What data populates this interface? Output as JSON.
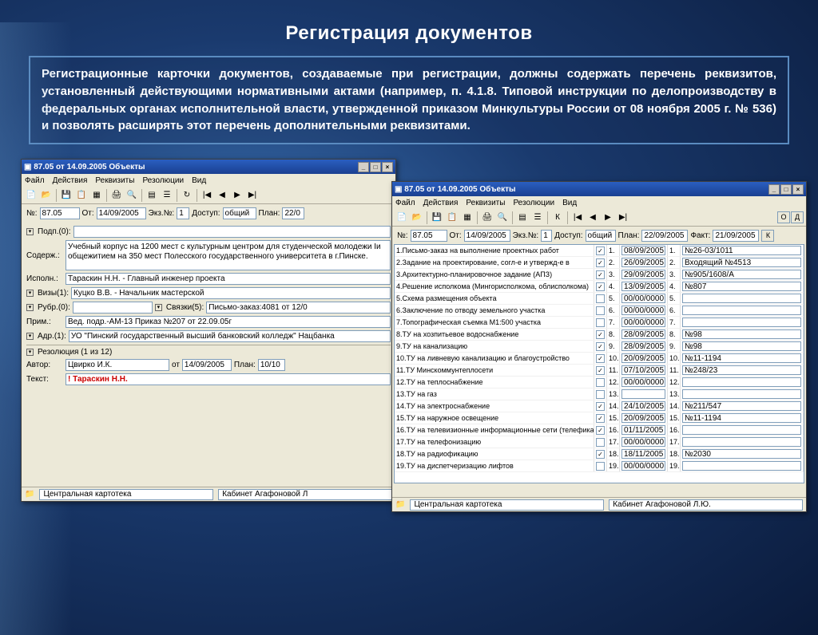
{
  "slide": {
    "title": "Регистрация документов",
    "body": "Регистрационные карточки документов, создаваемые при регистрации, должны содержать перечень реквизитов, установленный действующими нормативными актами (например, п. 4.1.8. Типовой инструкции по делопроизводству в федеральных органах исполнительной власти, утвержденной приказом Минкультуры России от 08 ноября 2005 г. № 536) и позволять расширять этот перечень дополнительными реквизитами."
  },
  "win1": {
    "title": "87.05 от 14.09.2005 Объекты",
    "menu": [
      "Файл",
      "Действия",
      "Реквизиты",
      "Резолюции",
      "Вид"
    ],
    "header": {
      "num_label": "№:",
      "num": "87.05",
      "date_label": "От:",
      "date": "14/09/2005",
      "copy_label": "Экз.№:",
      "copy": "1",
      "access_label": "Доступ:",
      "access": "общий",
      "plan_label": "План:",
      "plan": "22/0"
    },
    "fields": {
      "sign_label": "Подп.(0):",
      "content_label": "Содерж.:",
      "content": "Учебный корпус на 1200 мест с культурным центром для студенческой молодежи Iи общежитием на 350 мест Полесского государственного университета в г.Пинске.",
      "exec_label": "Исполн.:",
      "exec": "Тараскин Н.Н. - Главный инженер проекта",
      "visa_label": "Визы(1):",
      "visa": "Куцко В.В. - Начальник мастерской",
      "rubr_label": "Рубр.(0):",
      "links_label": "Связки(5):",
      "links": "Письмо-заказ:4081 от 12/0",
      "prim_label": "Прим.:",
      "prim": "Вед. подр.-АМ-13 Приказ №207 от 22.09.05г",
      "addr_label": "Адр.(1):",
      "addr": "УО \"Пинский государственный высший банковский колледж\" Нацбанка",
      "res_label": "Резолюция (1 из 12)",
      "author_label": "Автор:",
      "author": "Цвирко И.К.",
      "res_date_label": "от",
      "res_date": "14/09/2005",
      "res_plan_label": "План:",
      "res_plan": "10/10",
      "text_label": "Текст:",
      "text_val": "! Тараскин Н.Н."
    },
    "status": {
      "folder": "Центральная картотека",
      "cabinet": "Кабинет Агафоновой Л"
    }
  },
  "win2": {
    "title": "87.05 от 14.09.2005 Объекты",
    "menu": [
      "Файл",
      "Действия",
      "Реквизиты",
      "Резолюции",
      "Вид"
    ],
    "header": {
      "num_label": "№:",
      "num": "87.05",
      "date_label": "От:",
      "date": "14/09/2005",
      "copy_label": "Экз.№:",
      "copy": "1",
      "access_label": "Доступ:",
      "access": "общий",
      "plan_label": "План:",
      "plan": "22/09/2005",
      "fact_label": "Факт:",
      "fact": "21/09/2005",
      "k": "К",
      "o": "О",
      "d": "Д"
    },
    "list": [
      {
        "n": "1",
        "name": "Письмо-заказ на выполнение проектных работ",
        "chk": true,
        "d": "08/09/2005",
        "ref": "№26-03/1011"
      },
      {
        "n": "2",
        "name": "Задание на проектирование, согл-е и утвержд-е в",
        "chk": true,
        "d": "26/09/2005",
        "ref": "Входящий №4513"
      },
      {
        "n": "3",
        "name": "Архитектурно-планировочное задание (АПЗ)",
        "chk": true,
        "d": "29/09/2005",
        "ref": "№905/1608/А"
      },
      {
        "n": "4",
        "name": "Решение исполкома (Мингорисполкома, облисполкома)",
        "chk": true,
        "d": "13/09/2005",
        "ref": "№807"
      },
      {
        "n": "5",
        "name": "Схема размещения объекта",
        "chk": false,
        "d": "00/00/0000",
        "ref": ""
      },
      {
        "n": "6",
        "name": "Заключение по отводу земельного участка",
        "chk": false,
        "d": "00/00/0000",
        "ref": ""
      },
      {
        "n": "7",
        "name": "Топографическая съемка М1:500 участка",
        "chk": false,
        "d": "00/00/0000",
        "ref": ""
      },
      {
        "n": "8",
        "name": "ТУ на хозпитьевое водоснабжение",
        "chk": true,
        "d": "28/09/2005",
        "ref": "№98"
      },
      {
        "n": "9",
        "name": "ТУ на канализацию",
        "chk": true,
        "d": "28/09/2005",
        "ref": "№98"
      },
      {
        "n": "10",
        "name": "ТУ на ливневую канализацию и благоустройство",
        "chk": true,
        "d": "20/09/2005",
        "ref": "№11-1194"
      },
      {
        "n": "11",
        "name": "ТУ Минскоммунтеплосети",
        "chk": true,
        "d": "07/10/2005",
        "ref": "№248/23"
      },
      {
        "n": "12",
        "name": "ТУ на теплоснабжение",
        "chk": false,
        "d": "00/00/0000",
        "ref": ""
      },
      {
        "n": "13",
        "name": "ТУ на газ",
        "chk": false,
        "d": "",
        "ref": ""
      },
      {
        "n": "14",
        "name": "ТУ на электроснабжение",
        "chk": true,
        "d": "24/10/2005",
        "ref": "№211/547"
      },
      {
        "n": "15",
        "name": "ТУ на наружное освещение",
        "chk": true,
        "d": "20/09/2005",
        "ref": "№11-1194"
      },
      {
        "n": "16",
        "name": "ТУ на телевизионные информационные сети (телефикация)",
        "chk": true,
        "d": "01/11/2005",
        "ref": ""
      },
      {
        "n": "17",
        "name": "ТУ на телефонизацию",
        "chk": false,
        "d": "00/00/0000",
        "ref": ""
      },
      {
        "n": "18",
        "name": "ТУ на радиофикацию",
        "chk": true,
        "d": "18/11/2005",
        "ref": "№2030"
      },
      {
        "n": "19",
        "name": "ТУ на диспетчеризацию лифтов",
        "chk": false,
        "d": "00/00/0000",
        "ref": ""
      }
    ],
    "status": {
      "folder": "Центральная картотека",
      "cabinet": "Кабинет Агафоновой Л.Ю."
    }
  }
}
